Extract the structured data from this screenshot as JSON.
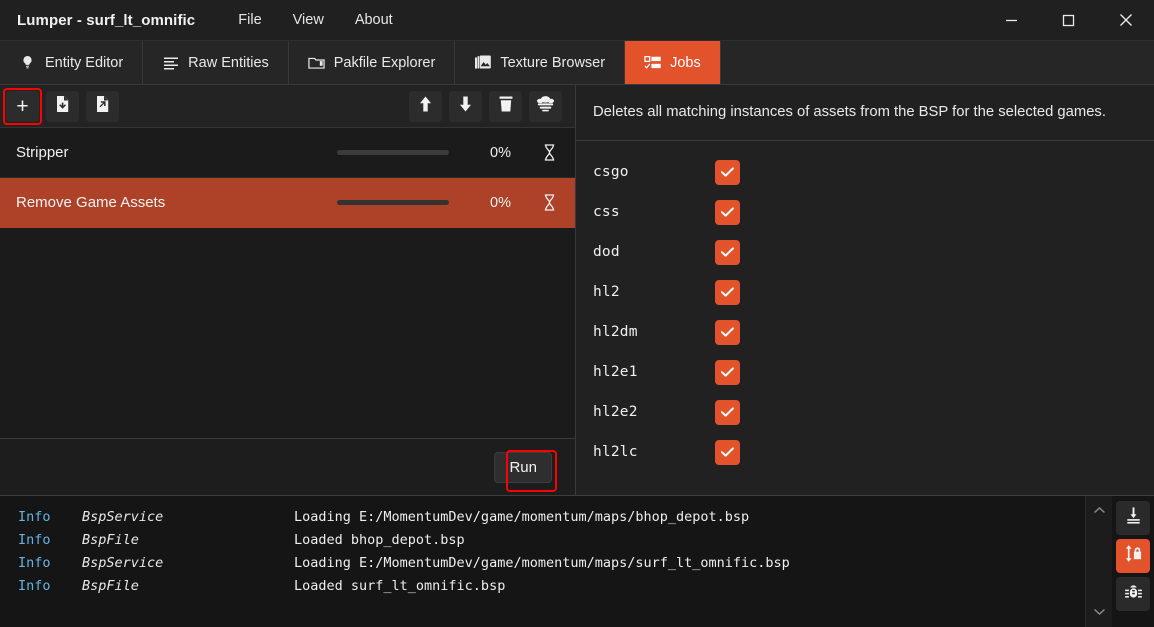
{
  "window": {
    "title": "Lumper - surf_lt_omnific",
    "menu": [
      "File",
      "View",
      "About"
    ],
    "controls": {
      "minimize": "minimize-icon",
      "maximize": "maximize-icon",
      "close": "close-icon"
    }
  },
  "colors": {
    "accent": "#e2522b",
    "selected_row": "#ad4228",
    "highlight_box": "#ff0000",
    "log_level": "#64b5e6",
    "background": "#1f1f1f"
  },
  "tabs": [
    {
      "label": "Entity Editor",
      "icon": "lightbulb-icon",
      "active": false
    },
    {
      "label": "Raw Entities",
      "icon": "list-lines-icon",
      "active": false
    },
    {
      "label": "Pakfile Explorer",
      "icon": "archive-icon",
      "active": false
    },
    {
      "label": "Texture Browser",
      "icon": "images-icon",
      "active": false
    },
    {
      "label": "Jobs",
      "icon": "checklist-icon",
      "active": true
    }
  ],
  "job_toolbar": {
    "add": {
      "label": "+",
      "icon": "plus-icon",
      "highlighted": true
    },
    "import": {
      "icon": "file-import-icon"
    },
    "export": {
      "icon": "file-export-icon"
    },
    "move_up": {
      "icon": "arrow-up-icon"
    },
    "move_down": {
      "icon": "arrow-down-icon"
    },
    "delete": {
      "icon": "trash-icon"
    },
    "nuke": {
      "icon": "explosion-icon"
    }
  },
  "jobs": {
    "columns": [
      "name",
      "progress",
      "percent",
      "status"
    ],
    "rows": [
      {
        "name": "Stripper",
        "progress": 0,
        "percent": "0%",
        "status_icon": "hourglass-icon",
        "selected": false
      },
      {
        "name": "Remove Game Assets",
        "progress": 0,
        "percent": "0%",
        "status_icon": "hourglass-icon",
        "selected": true
      }
    ]
  },
  "run": {
    "label": "Run",
    "highlighted": true
  },
  "details": {
    "description": "Deletes all matching instances of assets from the BSP for the selected games.",
    "games": [
      {
        "name": "csgo",
        "checked": true
      },
      {
        "name": "css",
        "checked": true
      },
      {
        "name": "dod",
        "checked": true
      },
      {
        "name": "hl2",
        "checked": true
      },
      {
        "name": "hl2dm",
        "checked": true
      },
      {
        "name": "hl2e1",
        "checked": true
      },
      {
        "name": "hl2e2",
        "checked": true
      },
      {
        "name": "hl2lc",
        "checked": true
      }
    ]
  },
  "console": {
    "entries": [
      {
        "level": "Info",
        "source": "BspService",
        "message": "Loading E:/MomentumDev/game/momentum/maps/bhop_depot.bsp"
      },
      {
        "level": "Info",
        "source": "BspFile",
        "message": "Loaded bhop_depot.bsp"
      },
      {
        "level": "Info",
        "source": "BspService",
        "message": "Loading E:/MomentumDev/game/momentum/maps/surf_lt_omnific.bsp"
      },
      {
        "level": "Info",
        "source": "BspFile",
        "message": "Loaded surf_lt_omnific.bsp"
      }
    ],
    "buttons": [
      {
        "icon": "scroll-to-bottom-icon",
        "active": false
      },
      {
        "icon": "scroll-lock-icon",
        "active": true
      },
      {
        "icon": "bug-icon",
        "active": false
      }
    ]
  }
}
